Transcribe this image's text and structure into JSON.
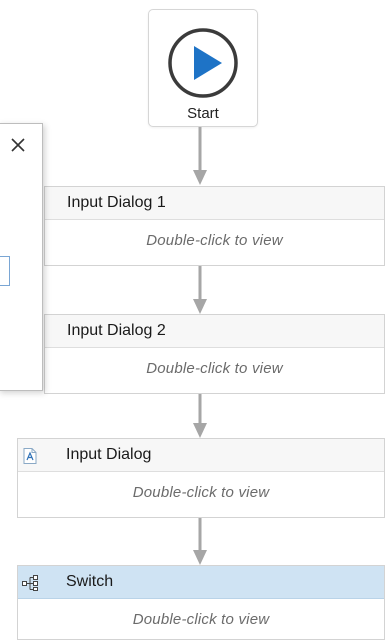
{
  "start": {
    "label": "Start",
    "icon": "play-icon",
    "color": "#1e73c6"
  },
  "activities": [
    {
      "title": "Input Dialog 1",
      "hint": "Double-click to view"
    },
    {
      "title": "Input Dialog 2",
      "hint": "Double-click to view"
    },
    {
      "title": "Input Dialog",
      "hint": "Double-click to view",
      "icon": "input-dialog-icon"
    },
    {
      "title": "Switch",
      "hint": "Double-click to view",
      "icon": "switch-icon",
      "selected": true
    }
  ],
  "dialog_panel": {
    "close_icon": "close-icon"
  },
  "colors": {
    "connector": "#a6a6a6",
    "selected_header": "#cfe3f3",
    "play": "#1e73c6"
  }
}
